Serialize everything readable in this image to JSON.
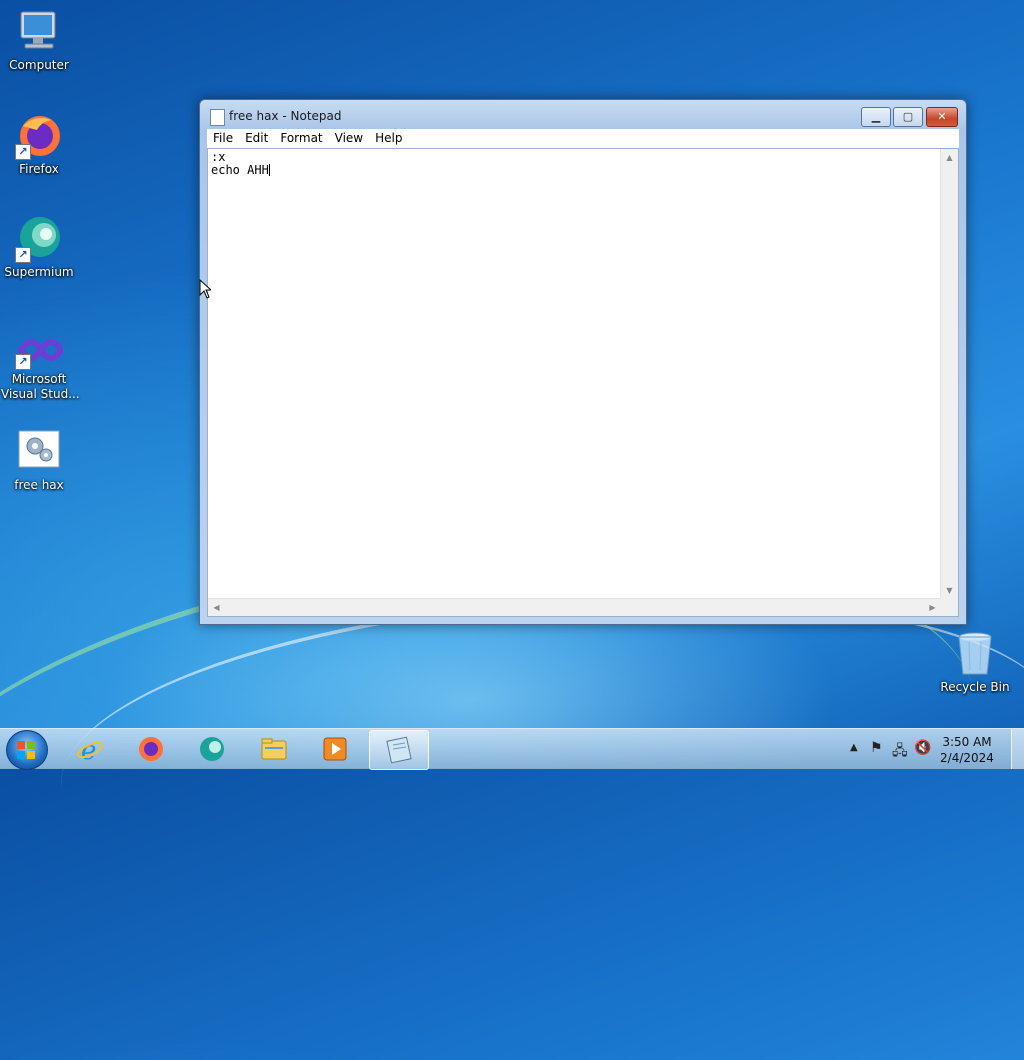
{
  "desktop": {
    "icons": [
      {
        "label": "Computer",
        "icon": "computer-icon"
      },
      {
        "label": "Firefox",
        "icon": "firefox-icon"
      },
      {
        "label": "Supermium",
        "icon": "supermium-icon"
      },
      {
        "label": "Microsoft\nVisual Stud...",
        "icon": "visual-studio-icon"
      },
      {
        "label": "free hax",
        "icon": "batch-file-icon"
      },
      {
        "label": "Recycle Bin",
        "icon": "recycle-bin-icon"
      }
    ]
  },
  "notepad": {
    "title": "free hax - Notepad",
    "menu": [
      "File",
      "Edit",
      "Format",
      "View",
      "Help"
    ],
    "content_line1": ":x",
    "content_line2": "echo AHH",
    "controls": {
      "minimize": "minimize-icon",
      "maximize": "maximize-icon",
      "close": "close-icon"
    }
  },
  "taskbar": {
    "pinned": [
      "internet-explorer-icon",
      "firefox-icon",
      "supermium-icon",
      "file-explorer-icon",
      "media-player-icon",
      "notepad-icon"
    ],
    "active": "notepad-icon",
    "tray_icons": [
      "show-hidden-icons-icon",
      "action-center-flag-icon",
      "network-icon",
      "volume-muted-icon"
    ],
    "time": "3:50 AM",
    "date": "2/4/2024"
  },
  "colors": {
    "accent": "#1a78cf",
    "close_button": "#c7452b"
  }
}
